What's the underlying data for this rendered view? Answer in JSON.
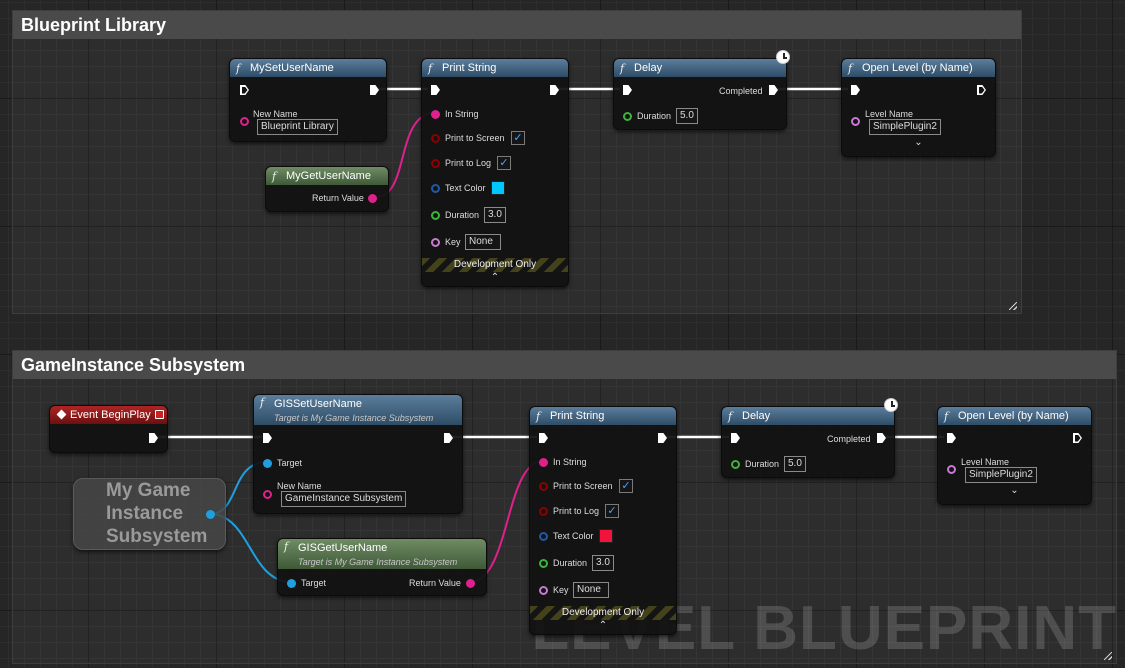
{
  "watermark": "LEVEL BLUEPRINT",
  "comments": {
    "top": {
      "title": "Blueprint Library"
    },
    "bottom": {
      "title": "GameInstance Subsystem"
    }
  },
  "icons": {
    "function": "f",
    "expand_down": "⌄",
    "expand_up": "⌃",
    "check": "✓"
  },
  "top_nodes": {
    "set_user": {
      "title": "MySetUserName",
      "new_name_label": "New Name",
      "new_name_value": "Blueprint Library"
    },
    "get_user": {
      "title": "MyGetUserName",
      "return_label": "Return Value"
    },
    "print": {
      "title": "Print String",
      "in_string": "In String",
      "print_screen": "Print to Screen",
      "print_log": "Print to Log",
      "text_color": "Text Color",
      "text_color_hex": "#00c8ff",
      "duration_label": "Duration",
      "duration_value": "3.0",
      "key_label": "Key",
      "key_value": "None",
      "dev_only": "Development Only"
    },
    "delay": {
      "title": "Delay",
      "completed": "Completed",
      "duration_label": "Duration",
      "duration_value": "5.0"
    },
    "open_level": {
      "title": "Open Level (by Name)",
      "level_label": "Level Name",
      "level_value": "SimplePlugin2"
    }
  },
  "bottom_nodes": {
    "begin_play": {
      "title": "Event BeginPlay"
    },
    "subsystem_ref": {
      "title": "My Game Instance Subsystem"
    },
    "gis_set": {
      "title": "GISSetUserName",
      "subtitle": "Target is My Game Instance Subsystem",
      "target_label": "Target",
      "new_name_label": "New Name",
      "new_name_value": "GameInstance Subsystem"
    },
    "gis_get": {
      "title": "GISGetUserName",
      "subtitle": "Target is My Game Instance Subsystem",
      "target_label": "Target",
      "return_label": "Return Value"
    },
    "print": {
      "title": "Print String",
      "in_string": "In String",
      "print_screen": "Print to Screen",
      "print_log": "Print to Log",
      "text_color": "Text Color",
      "text_color_hex": "#f0143c",
      "duration_label": "Duration",
      "duration_value": "3.0",
      "key_label": "Key",
      "key_value": "None",
      "dev_only": "Development Only"
    },
    "delay": {
      "title": "Delay",
      "completed": "Completed",
      "duration_label": "Duration",
      "duration_value": "5.0"
    },
    "open_level": {
      "title": "Open Level (by Name)",
      "level_label": "Level Name",
      "level_value": "SimplePlugin2"
    }
  },
  "colors": {
    "string_pin": "#e0208c",
    "bool_pin": "#8c0000",
    "color_pin": "#1e5aa8",
    "float_pin": "#3cb43c",
    "name_pin": "#c87ad0",
    "object_pin": "#1ea0e0",
    "exec": "#ffffff"
  }
}
